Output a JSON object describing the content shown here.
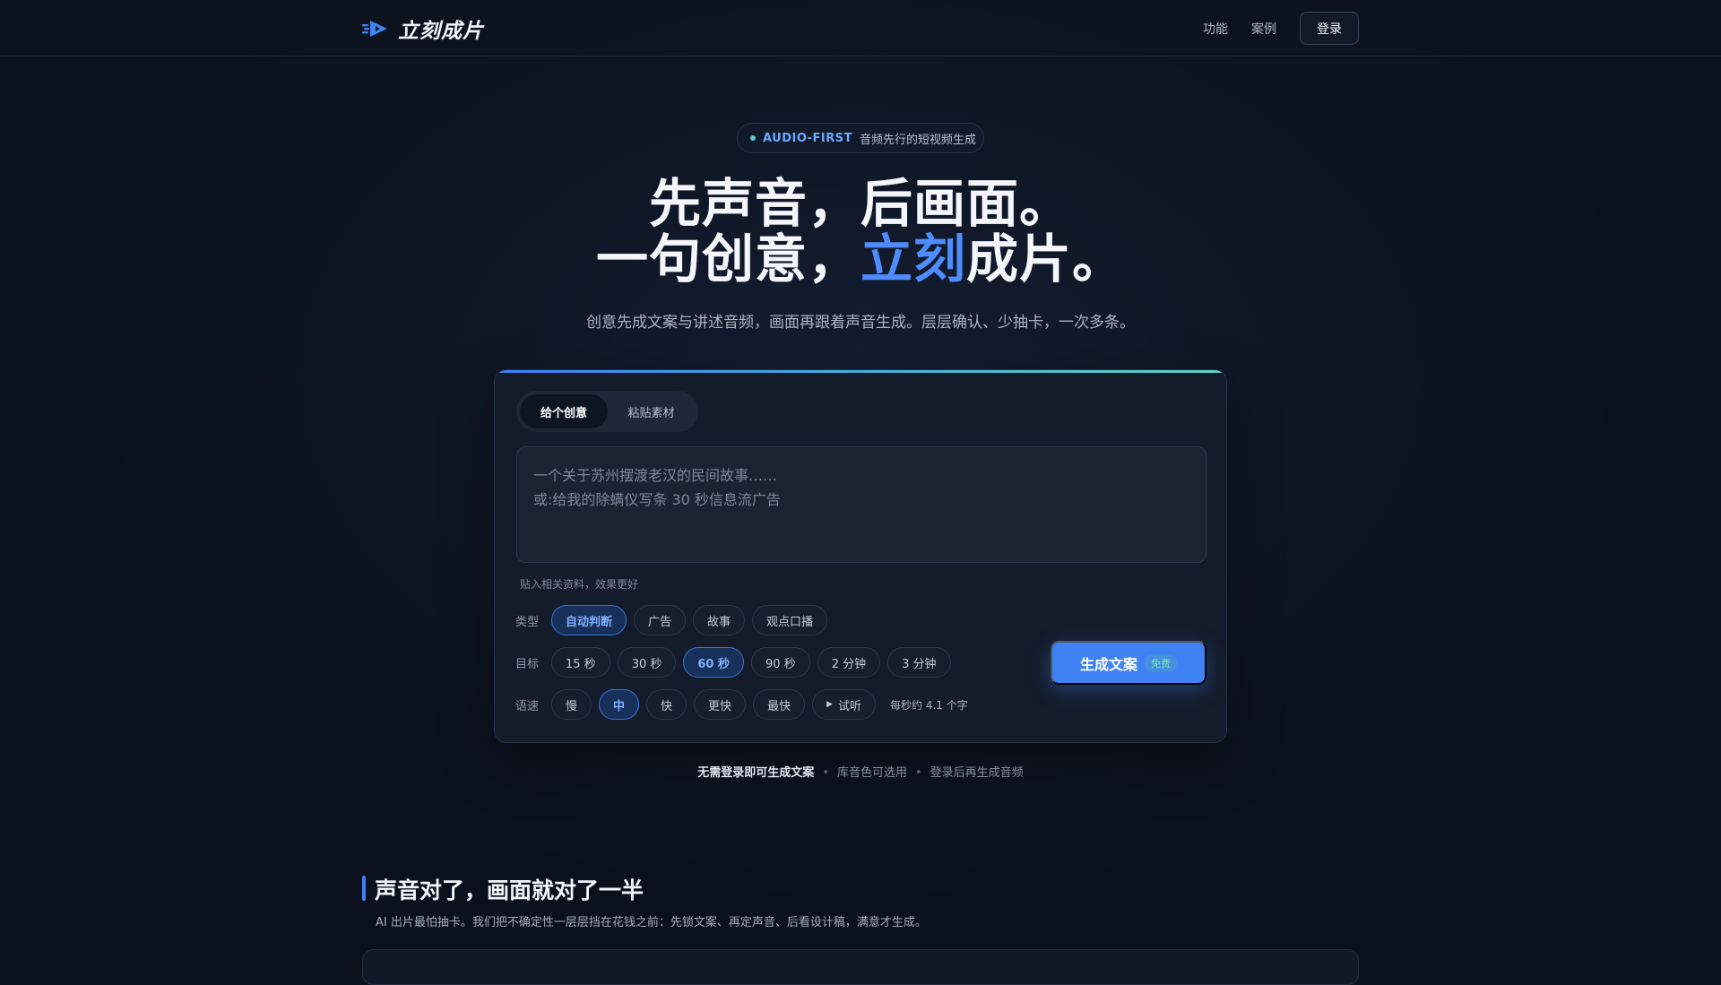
{
  "header": {
    "brand": "立刻成片",
    "nav": [
      "功能",
      "案例"
    ],
    "login_label": "登录"
  },
  "hero": {
    "pill_tag": "AUDIO-FIRST",
    "pill_text": "音频先行的短视频生成",
    "headline_line1": "先声音，后画面。",
    "headline_line2_pre": "一句创意，",
    "headline_line2_accent": "立刻",
    "headline_line2_post": "成片。",
    "subtitle": "创意先成文案与讲述音频，画面再跟着声音生成。层层确认、少抽卡，一次多条。"
  },
  "composer": {
    "tabs": [
      {
        "label": "给个创意",
        "active": true
      },
      {
        "label": "粘贴素材",
        "active": false
      }
    ],
    "input_value": "",
    "input_placeholder": "一个关于苏州摆渡老汉的民间故事……\n或:给我的除螨仪写条 30 秒信息流广告",
    "hint": "贴入相关资料，效果更好",
    "type": {
      "label": "类型",
      "options": [
        "自动判断",
        "广告",
        "故事",
        "观点口播"
      ],
      "selected": "自动判断"
    },
    "target": {
      "label": "目标",
      "options": [
        "15 秒",
        "30 秒",
        "60 秒",
        "90 秒",
        "2 分钟",
        "3 分钟"
      ],
      "selected": "60 秒"
    },
    "speed": {
      "label": "语速",
      "options": [
        "慢",
        "中",
        "快",
        "更快",
        "最快"
      ],
      "selected": "中",
      "preview_label": "试听",
      "rate_note": "每秒约 4.1 个字"
    },
    "generate_label": "生成文案",
    "free_badge": "免费"
  },
  "footnote": {
    "strong": "无需登录即可生成文案",
    "item2": "库音色可选用",
    "item3": "登录后再生成音频",
    "separator": "•"
  },
  "section": {
    "title": "声音对了，画面就对了一半",
    "desc": "AI 出片最怕抽卡。我们把不确定性一层层挡在花钱之前：先锁文案、再定声音、后看设计稿，满意才生成。"
  },
  "colors": {
    "accent": "#3f82f5",
    "accent_text": "#4d8dff",
    "background": "#0d1320",
    "card": "#141c2b"
  },
  "icons": {
    "brand": "play-arrow-logo-icon",
    "preview": "play-icon",
    "pill": "status-dot-icon"
  }
}
